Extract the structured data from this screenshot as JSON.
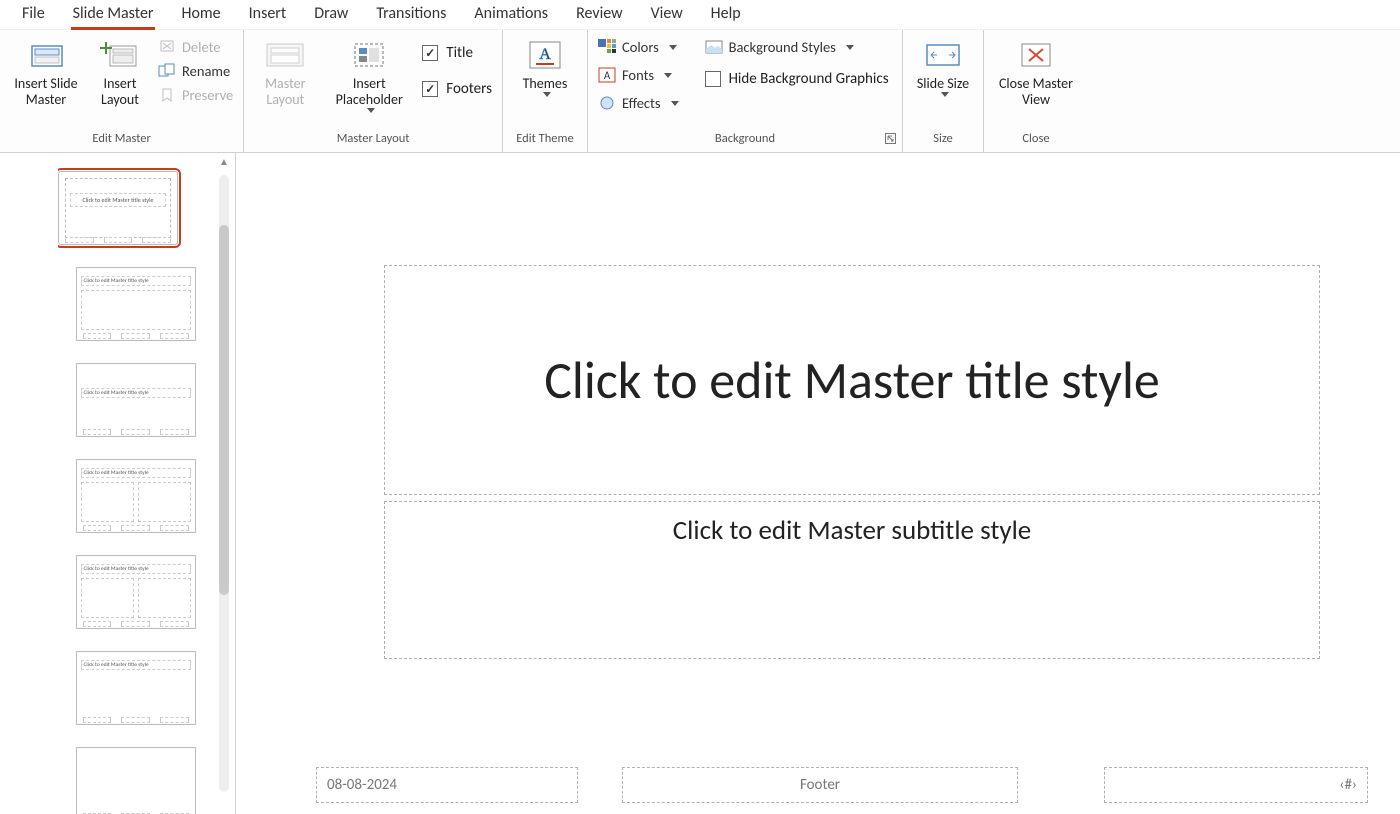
{
  "tabs": {
    "file": "File",
    "slide_master": "Slide Master",
    "home": "Home",
    "insert": "Insert",
    "draw": "Draw",
    "transitions": "Transitions",
    "animations": "Animations",
    "review": "Review",
    "view": "View",
    "help": "Help"
  },
  "ribbon": {
    "edit_master": {
      "label": "Edit Master",
      "insert_slide_master": "Insert Slide Master",
      "insert_layout": "Insert Layout",
      "delete": "Delete",
      "rename": "Rename",
      "preserve": "Preserve"
    },
    "master_layout": {
      "label": "Master Layout",
      "master_layout_btn": "Master Layout",
      "insert_placeholder": "Insert Placeholder",
      "title_cb": "Title",
      "footers_cb": "Footers"
    },
    "edit_theme": {
      "label": "Edit Theme",
      "themes": "Themes"
    },
    "background": {
      "label": "Background",
      "colors": "Colors",
      "fonts": "Fonts",
      "effects": "Effects",
      "background_styles": "Background Styles",
      "hide_bg": "Hide Background Graphics"
    },
    "size": {
      "label": "Size",
      "slide_size": "Slide Size"
    },
    "close": {
      "label": "Close",
      "close_master_view": "Close Master View"
    }
  },
  "slide": {
    "title_placeholder": "Click to edit Master title style",
    "subtitle_placeholder": "Click to edit Master subtitle style",
    "date": "08-08-2024",
    "footer": "Footer",
    "slide_number": "‹#›"
  },
  "thumbs": {
    "master_title": "Click to edit Master title style",
    "layout_title": "Click to edit Master title style"
  }
}
